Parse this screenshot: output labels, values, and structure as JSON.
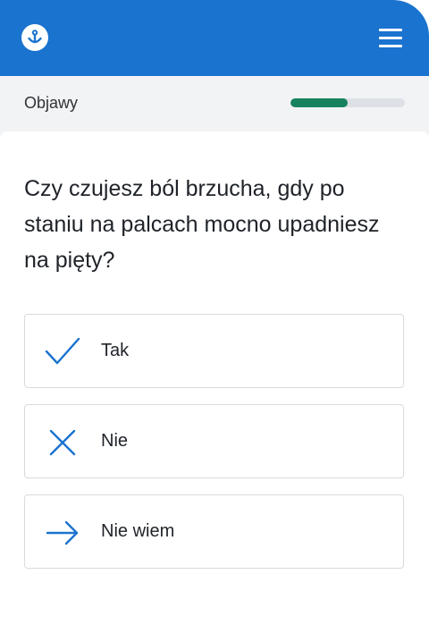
{
  "header": {
    "logo_icon": "lifebuoy-logo-icon",
    "menu_icon": "hamburger-menu-icon",
    "background_color": "#1a73cf"
  },
  "section": {
    "label": "Objawy",
    "progress_fraction": 0.5,
    "progress_color": "#17835e"
  },
  "question": {
    "text": "Czy czujesz ból brzucha, gdy po staniu na palcach mocno upadniesz na pięty?"
  },
  "options": [
    {
      "label": "Tak",
      "icon": "check-icon"
    },
    {
      "label": "Nie",
      "icon": "close-x-icon"
    },
    {
      "label": "Nie wiem",
      "icon": "arrow-right-icon"
    }
  ],
  "colors": {
    "accent": "#1a73cf",
    "text": "#1f2329"
  }
}
